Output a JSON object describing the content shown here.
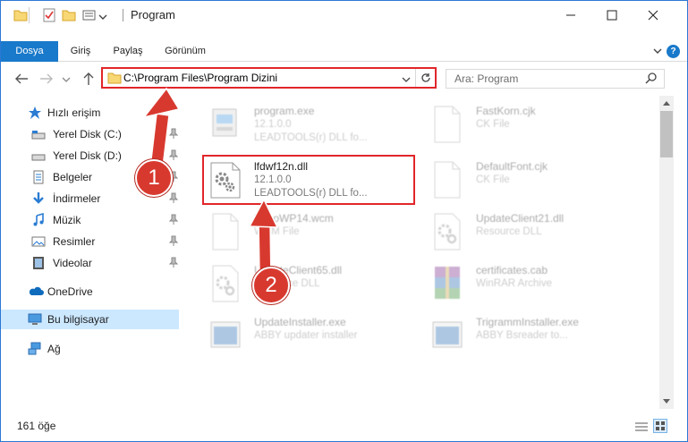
{
  "window": {
    "title": "Program",
    "controls": {
      "minimize": "minimize",
      "maximize": "maximize",
      "close": "close"
    }
  },
  "ribbon": {
    "tabs": [
      "Dosya",
      "Giriş",
      "Paylaş",
      "Görünüm"
    ],
    "help": "?"
  },
  "address": {
    "path": "C:\\Program Files\\Program Dizini",
    "search_placeholder": "Ara: Program"
  },
  "nav": {
    "items": [
      {
        "label": "Hızlı erişim",
        "icon": "star-icon",
        "pinned": false
      },
      {
        "label": "Yerel Disk (C:)",
        "icon": "drive-icon",
        "pinned": true
      },
      {
        "label": "Yerel Disk (D:)",
        "icon": "drive-icon",
        "pinned": true
      },
      {
        "label": "Belgeler",
        "icon": "documents-icon",
        "pinned": true
      },
      {
        "label": "İndirmeler",
        "icon": "download-icon",
        "pinned": true
      },
      {
        "label": "Müzik",
        "icon": "music-icon",
        "pinned": true
      },
      {
        "label": "Resimler",
        "icon": "pictures-icon",
        "pinned": true
      },
      {
        "label": "Videolar",
        "icon": "video-icon",
        "pinned": true
      },
      {
        "label": "OneDrive",
        "icon": "cloud-icon",
        "pinned": false
      },
      {
        "label": "Bu bilgisayar",
        "icon": "computer-icon",
        "pinned": false
      },
      {
        "label": "Ağ",
        "icon": "network-icon",
        "pinned": false
      }
    ]
  },
  "files": [
    {
      "name": "program.exe",
      "line2": "12.1.0.0",
      "line3": "LEADTOOLS(r) DLL fo...",
      "icon": "exe-icon"
    },
    {
      "name": "FastKorn.cjk",
      "line2": "CK File",
      "line3": "",
      "icon": "blank-file-icon"
    },
    {
      "name": "lfdwf12n.dll",
      "line2": "12.1.0.0",
      "line3": "LEADTOOLS(r) DLL fo...",
      "icon": "dll-gear-icon"
    },
    {
      "name": "DefaultFont.cjk",
      "line2": "CK File",
      "line3": "",
      "icon": "blank-file-icon"
    },
    {
      "name": "RecoWP14.wcm",
      "line2": "WCM File",
      "line3": "",
      "icon": "blank-file-icon"
    },
    {
      "name": "UpdateClient21.dll",
      "line2": "Resource DLL",
      "line3": "",
      "icon": "dll-gear-icon"
    },
    {
      "name": "UpdateClient65.dll",
      "line2": "Resource DLL",
      "line3": "",
      "icon": "dll-gear-icon"
    },
    {
      "name": "certificates.cab",
      "line2": "WinRAR Archive",
      "line3": "",
      "icon": "winrar-icon"
    },
    {
      "name": "UpdateInstaller.exe",
      "line2": "ABBY updater installer",
      "line3": "",
      "icon": "installer-icon"
    },
    {
      "name": "TrigrammInstaller.exe",
      "line2": "ABBY Bsreader to...",
      "line3": "",
      "icon": "installer-icon"
    }
  ],
  "status": {
    "count": "161 öğe"
  },
  "annotations": {
    "step1": "1",
    "step2": "2"
  },
  "colors": {
    "accent": "#1979ca",
    "highlight_border": "#e1262a",
    "callout": "#d8392f",
    "selected_nav": "#cce8ff"
  }
}
